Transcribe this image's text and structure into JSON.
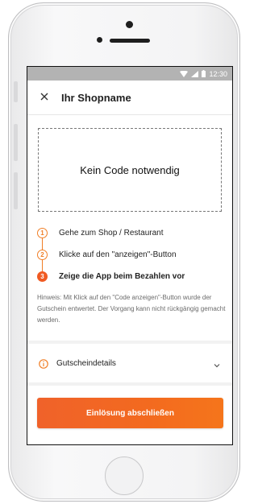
{
  "status_bar": {
    "time": "12:30"
  },
  "header": {
    "title": "Ihr Shopname",
    "close_icon": "close-icon"
  },
  "code_box": {
    "text": "Kein Code notwendig"
  },
  "steps": [
    {
      "number": "1",
      "text": "Gehe zum Shop / Restaurant",
      "active": false
    },
    {
      "number": "2",
      "text": "Klicke auf den \"anzeigen\"-Button",
      "active": false
    },
    {
      "number": "3",
      "text": "Zeige die App beim Bezahlen vor",
      "active": true
    }
  ],
  "hint": "Hinweis: Mit Klick auf den \"Code anzeigen\"-Button wurde der Gutschein entwertet. Der Vorgang kann nicht rückgängig gemacht werden.",
  "details": {
    "label": "Gutscheindetails",
    "icon": "info-icon",
    "chevron": "chevron-down-icon"
  },
  "cta": {
    "label": "Einlösung abschließen"
  },
  "colors": {
    "accent": "#f05a22",
    "step_outline": "#f07e26",
    "status_bar": "#b3b3b3"
  }
}
